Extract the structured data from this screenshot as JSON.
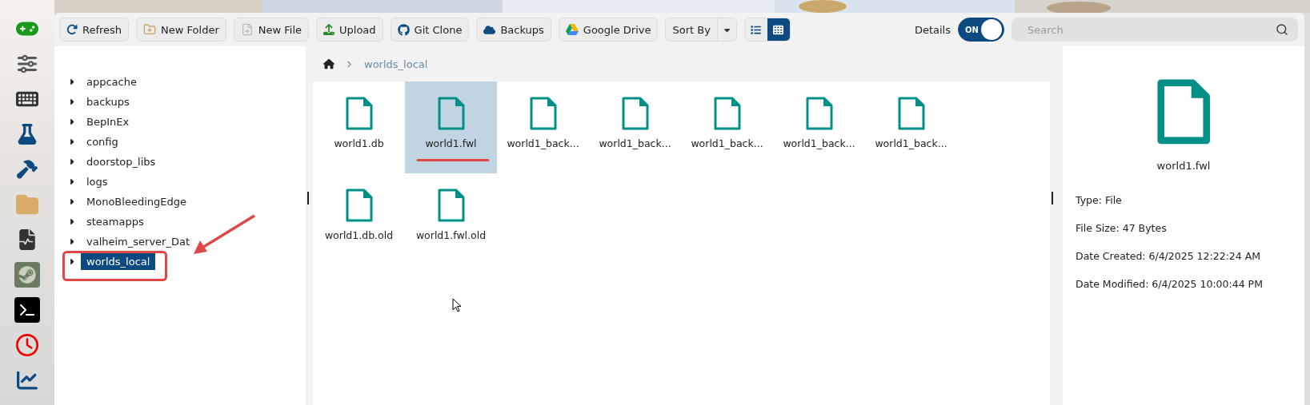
{
  "toolbar": {
    "buttons": [
      {
        "label": "Refresh"
      },
      {
        "label": "New Folder"
      },
      {
        "label": "New File"
      },
      {
        "label": "Upload"
      },
      {
        "label": "Git Clone"
      },
      {
        "label": "Backups"
      },
      {
        "label": "Google Drive"
      }
    ],
    "sort": {
      "label": "Sort By"
    },
    "views": [
      {
        "kind": "list",
        "selected": false
      },
      {
        "kind": "grid",
        "selected": true
      }
    ],
    "details_toggle": {
      "label": "Details",
      "on": true,
      "text": "ON"
    },
    "search": {
      "placeholder": "Search"
    }
  },
  "tree": {
    "items": [
      {
        "label": "appcache",
        "selected": false
      },
      {
        "label": "backups",
        "selected": false
      },
      {
        "label": "BepInEx",
        "selected": false
      },
      {
        "label": "config",
        "selected": false
      },
      {
        "label": "doorstop_libs",
        "selected": false
      },
      {
        "label": "logs",
        "selected": false
      },
      {
        "label": "MonoBleedingEdge",
        "selected": false
      },
      {
        "label": "steamapps",
        "selected": false
      },
      {
        "label": "valheim_server_Dat",
        "selected": false
      },
      {
        "label": "worlds_local",
        "selected": true
      }
    ]
  },
  "breadcrumb": [
    "worlds_local"
  ],
  "files": [
    {
      "name": "world1.db",
      "selected": false
    },
    {
      "name": "world1.fwl",
      "selected": true
    },
    {
      "name": "world1_back...",
      "selected": false
    },
    {
      "name": "world1_back...",
      "selected": false
    },
    {
      "name": "world1_back...",
      "selected": false
    },
    {
      "name": "world1_back...",
      "selected": false
    },
    {
      "name": "world1_back...",
      "selected": false
    },
    {
      "name": "world1.db.old",
      "selected": false
    },
    {
      "name": "world1.fwl.old",
      "selected": false
    }
  ],
  "details": {
    "name": "world1.fwl",
    "properties": [
      "Type: File",
      "File Size: 47 Bytes",
      "Date Created: 6/4/2025 12:22:24 AM",
      "Date Modified: 6/4/2025 10:00:44 PM"
    ]
  }
}
